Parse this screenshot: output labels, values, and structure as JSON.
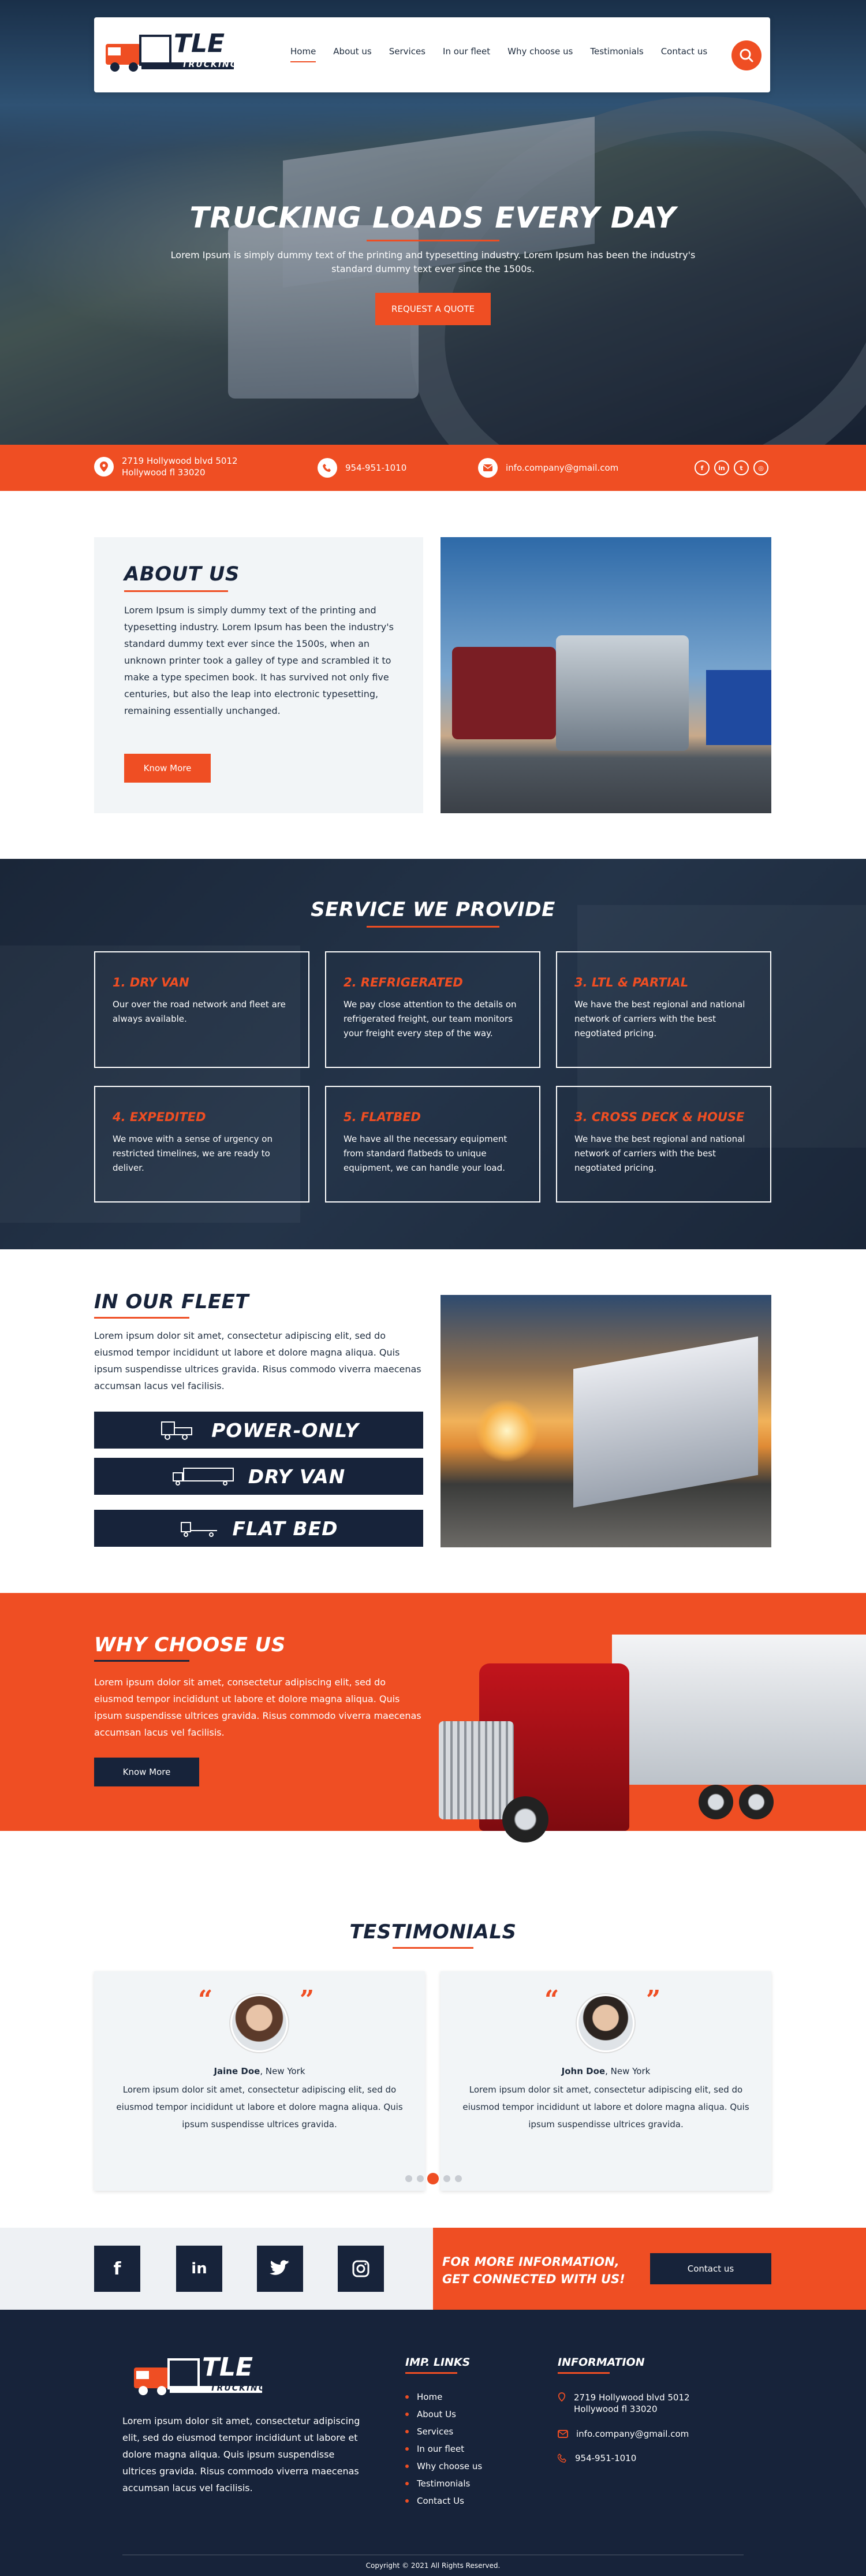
{
  "brand": {
    "logo_main": "TLE",
    "logo_sub": "TRUCKING"
  },
  "nav": {
    "items": [
      "Home",
      "About us",
      "Services",
      "In our fleet",
      "Why choose us",
      "Testimonials",
      "Contact us"
    ],
    "active": "Home"
  },
  "hero": {
    "title": "TRUCKING LOADS EVERY DAY",
    "subtitle": "Lorem Ipsum is simply dummy text of the printing and typesetting industry. Lorem Ipsum has been the industry's standard dummy text ever since the 1500s.",
    "cta": "REQUEST A QUOTE"
  },
  "contact_bar": {
    "address_line1": "2719 Hollywood blvd 5012",
    "address_line2": "Hollywood fl 33020",
    "phone": "954-951-1010",
    "email": "info.company@gmail.com"
  },
  "about": {
    "title": "ABOUT US",
    "text": "Lorem Ipsum is simply dummy text of the printing and typesetting industry. Lorem Ipsum has been the industry's standard dummy text ever since the 1500s, when an unknown printer took a galley of type and scrambled it to make a type specimen book. It has survived not only five centuries, but also the leap into electronic typesetting, remaining essentially unchanged.",
    "button": "Know More"
  },
  "services": {
    "title": "SERVICE WE PROVIDE",
    "items": [
      {
        "title": "1. DRY VAN",
        "text": "Our over the road network and fleet are always available."
      },
      {
        "title": "2. REFRIGERATED",
        "text": "We pay close attention to the details on refrigerated freight, our team monitors your freight every step of the way."
      },
      {
        "title": "3. LTL & PARTIAL",
        "text": "We have the best regional and national network of carriers with the best negotiated pricing."
      },
      {
        "title": "4. EXPEDITED",
        "text": "We move with a sense of urgency on restricted timelines, we are ready to deliver."
      },
      {
        "title": "5. FLATBED",
        "text": "We have all the necessary equipment from standard flatbeds to unique equipment, we can handle your load."
      },
      {
        "title": "3. CROSS DECK & HOUSE",
        "text": "We have the best regional and national network of carriers with the best negotiated pricing."
      }
    ]
  },
  "fleet": {
    "title": "IN OUR FLEET",
    "text": "Lorem ipsum dolor sit amet, consectetur adipiscing elit, sed do eiusmod tempor incididunt ut labore et dolore magna aliqua. Quis ipsum suspendisse ultrices gravida. Risus commodo viverra maecenas accumsan lacus vel facilisis.",
    "items": [
      "POWER-ONLY",
      "DRY VAN",
      "FLAT BED"
    ]
  },
  "why": {
    "title": "WHY CHOOSE US",
    "text": "Lorem ipsum dolor sit amet, consectetur adipiscing elit, sed do eiusmod tempor incididunt ut labore et dolore magna aliqua. Quis ipsum suspendisse ultrices gravida. Risus commodo viverra maecenas accumsan lacus vel facilisis.",
    "button": "Know More"
  },
  "testimonials": {
    "title": "TESTIMONIALS",
    "items": [
      {
        "name": "Jaine Doe",
        "location": ", New York",
        "text": "Lorem ipsum dolor sit amet, consectetur adipiscing elit, sed do eiusmod tempor incididunt ut labore et dolore magna aliqua. Quis ipsum suspendisse ultrices gravida."
      },
      {
        "name": "John Doe",
        "location": ", New York",
        "text": "Lorem ipsum dolor sit amet, consectetur adipiscing elit, sed do eiusmod tempor incididunt ut labore et dolore magna aliqua. Quis ipsum suspendisse ultrices gravida."
      }
    ],
    "active_dot": 3
  },
  "cta": {
    "line1": "FOR MORE INFORMATION,",
    "line2": "GET CONNECTED WITH US!",
    "button": "Contact us"
  },
  "footer": {
    "about_text": "Lorem ipsum dolor sit amet, consectetur adipiscing elit, sed do eiusmod tempor incididunt ut labore et dolore magna aliqua. Quis ipsum suspendisse ultrices gravida. Risus commodo viverra maecenas accumsan lacus vel facilisis.",
    "links_title": "IMP. LINKS",
    "links": [
      "Home",
      "About Us",
      "Services",
      "In our fleet",
      "Why choose us",
      "Testimonials",
      "Contact Us"
    ],
    "info_title": "INFORMATION",
    "address_line1": "2719 Hollywood blvd 5012",
    "address_line2": "Hollywood fl 33020",
    "email": "info.company@gmail.com",
    "phone": "954-951-1010",
    "copyright": "Copyright © 2021 All Rights Reserved."
  },
  "colors": {
    "accent": "#ef4e23",
    "dark": "#17233a",
    "light": "#f2f5f7"
  }
}
